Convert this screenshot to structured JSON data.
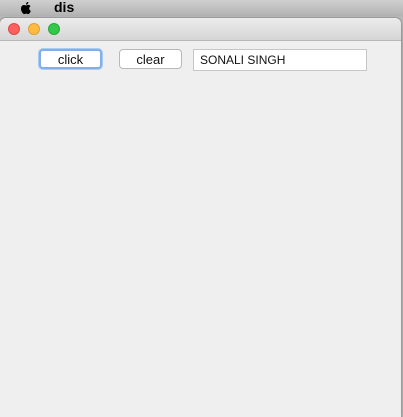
{
  "menubar": {
    "app_name": "dis",
    "apple_icon": "apple-icon"
  },
  "window": {
    "controls": [
      "close-icon",
      "minimize-icon",
      "maximize-icon"
    ],
    "click_button_label": "click",
    "clear_button_label": "clear",
    "text_field_value": "SONALI SINGH"
  },
  "colors": {
    "close": "#fc605c",
    "minimize": "#fdbc40",
    "maximize": "#34c84a",
    "focus_ring": "#7fb0ec",
    "window_bg": "#efefef"
  }
}
